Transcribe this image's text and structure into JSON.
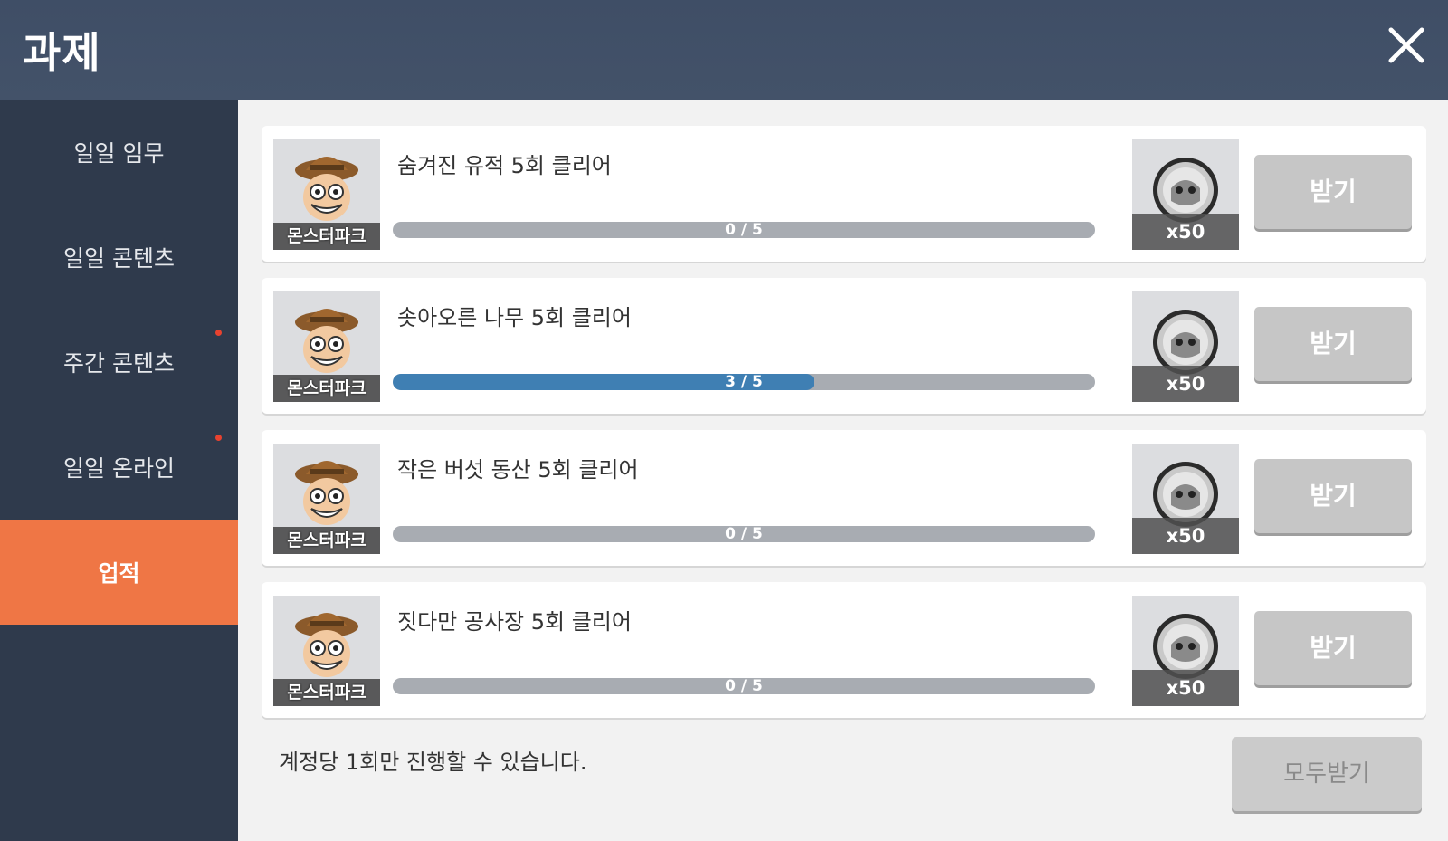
{
  "header": {
    "title": "과제"
  },
  "sidebar": {
    "items": [
      {
        "label": "일일 임무",
        "active": false,
        "notification": false
      },
      {
        "label": "일일 콘텐츠",
        "active": false,
        "notification": false
      },
      {
        "label": "주간 콘텐츠",
        "active": false,
        "notification": true
      },
      {
        "label": "일일 온라인",
        "active": false,
        "notification": true
      },
      {
        "label": "업적",
        "active": true,
        "notification": false
      }
    ]
  },
  "tasks": [
    {
      "title": "숨겨진 유적 5회 클리어",
      "icon_caption": "몬스터파크",
      "progress_text": "0 / 5",
      "progress_current": 0,
      "progress_total": 5,
      "reward_qty": "x50",
      "claim_label": "받기"
    },
    {
      "title": "솟아오른 나무 5회 클리어",
      "icon_caption": "몬스터파크",
      "progress_text": "3 / 5",
      "progress_current": 3,
      "progress_total": 5,
      "reward_qty": "x50",
      "claim_label": "받기"
    },
    {
      "title": "작은 버섯 동산 5회 클리어",
      "icon_caption": "몬스터파크",
      "progress_text": "0 / 5",
      "progress_current": 0,
      "progress_total": 5,
      "reward_qty": "x50",
      "claim_label": "받기"
    },
    {
      "title": "짓다만 공사장 5회 클리어",
      "icon_caption": "몬스터파크",
      "progress_text": "0 / 5",
      "progress_current": 0,
      "progress_total": 5,
      "reward_qty": "x50",
      "claim_label": "받기"
    }
  ],
  "footer": {
    "note": "계정당 1회만 진행할 수 있습니다.",
    "claim_all_label": "모두받기"
  },
  "colors": {
    "header_bg": "#435269",
    "sidebar_bg": "#2f3a4c",
    "active_tab": "#ef7645",
    "progress_fill": "#3f7fb3",
    "notification_dot": "#e8422f"
  },
  "icons": {
    "close": "close-icon",
    "task": "monster-park-npc-icon",
    "reward": "coin-icon"
  }
}
